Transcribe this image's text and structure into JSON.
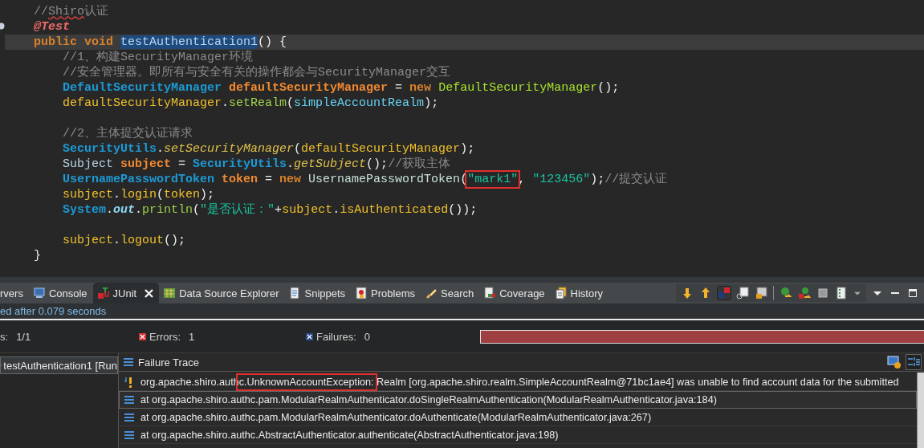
{
  "editor": {
    "lines": [
      {
        "current": false,
        "tokens": [
          {
            "text": "//",
            "kind": "comment"
          },
          {
            "text": "Shiro",
            "kind": "comment-misspelled"
          },
          {
            "text": "认证",
            "kind": "comment"
          }
        ]
      },
      {
        "current": false,
        "tokens": [
          {
            "text": "@Test",
            "kind": "annotation"
          }
        ]
      },
      {
        "current": true,
        "tokens": [
          {
            "text": "public ",
            "kind": "keyword"
          },
          {
            "text": "void ",
            "kind": "keyword"
          },
          {
            "text": "testAuthentication1",
            "kind": "occurrence"
          },
          {
            "text": "() {",
            "kind": "plain"
          }
        ],
        "children": [
          {
            "current": false,
            "tokens": [
              {
                "text": "//1、构建SecurityManager环境",
                "kind": "comment"
              }
            ]
          },
          {
            "current": false,
            "tokens": [
              {
                "text": "//安全管理器。即所有与安全有关的操作都会与SecurityManager交互",
                "kind": "comment"
              }
            ]
          },
          {
            "current": false,
            "tokens": [
              {
                "text": "DefaultSecurityManager ",
                "kind": "type"
              },
              {
                "text": "defaultSecurityManager",
                "kind": "local-decl"
              },
              {
                "text": " = ",
                "kind": "plain"
              },
              {
                "text": "new ",
                "kind": "keyword"
              },
              {
                "text": "DefaultSecurityManager",
                "kind": "constructor"
              },
              {
                "text": "();",
                "kind": "plain"
              }
            ]
          },
          {
            "current": false,
            "tokens": [
              {
                "text": "defaultSecurityManager",
                "kind": "local"
              },
              {
                "text": ".",
                "kind": "plain"
              },
              {
                "text": "setRealm",
                "kind": "method"
              },
              {
                "text": "(",
                "kind": "plain"
              },
              {
                "text": "simpleAccountRealm",
                "kind": "field"
              },
              {
                "text": ");",
                "kind": "plain"
              }
            ]
          },
          {
            "current": false,
            "kind": "blank"
          },
          {
            "current": false,
            "tokens": [
              {
                "text": "//2、主体提交认证请求",
                "kind": "comment"
              }
            ]
          },
          {
            "current": false,
            "tokens": [
              {
                "text": "SecurityUtils",
                "kind": "type"
              },
              {
                "text": ".",
                "kind": "plain"
              },
              {
                "text": "setSecurityManager",
                "kind": "static-method"
              },
              {
                "text": "(",
                "kind": "plain"
              },
              {
                "text": "defaultSecurityManager",
                "kind": "local"
              },
              {
                "text": ");",
                "kind": "plain"
              }
            ]
          },
          {
            "current": false,
            "tokens": [
              {
                "text": "Subject ",
                "kind": "plain-type"
              },
              {
                "text": "subject",
                "kind": "local-decl"
              },
              {
                "text": " = ",
                "kind": "plain"
              },
              {
                "text": "SecurityUtils",
                "kind": "type"
              },
              {
                "text": ".",
                "kind": "plain"
              },
              {
                "text": "getSubject",
                "kind": "static-method"
              },
              {
                "text": "();",
                "kind": "plain"
              },
              {
                "text": "//获取主体",
                "kind": "comment"
              }
            ]
          },
          {
            "current": false,
            "tokens": [
              {
                "text": "UsernamePasswordToken ",
                "kind": "type"
              },
              {
                "text": "token",
                "kind": "local-decl"
              },
              {
                "text": " = ",
                "kind": "plain"
              },
              {
                "text": "new ",
                "kind": "keyword"
              },
              {
                "text": "UsernamePasswordToken",
                "kind": "class-ref"
              },
              {
                "text": "(",
                "kind": "plain"
              },
              {
                "text": "\"mark1\"",
                "kind": "boxed-string"
              },
              {
                "text": ", ",
                "kind": "plain"
              },
              {
                "text": "\"123456\"",
                "kind": "string"
              },
              {
                "text": ");",
                "kind": "plain"
              },
              {
                "text": "//提交认证",
                "kind": "comment"
              }
            ]
          },
          {
            "current": false,
            "tokens": [
              {
                "text": "subject",
                "kind": "local"
              },
              {
                "text": ".",
                "kind": "plain"
              },
              {
                "text": "login",
                "kind": "local"
              },
              {
                "text": "(",
                "kind": "plain"
              },
              {
                "text": "token",
                "kind": "local"
              },
              {
                "text": ");",
                "kind": "plain"
              }
            ]
          },
          {
            "current": false,
            "tokens": [
              {
                "text": "System",
                "kind": "type"
              },
              {
                "text": ".",
                "kind": "plain"
              },
              {
                "text": "out",
                "kind": "static-field"
              },
              {
                "text": ".",
                "kind": "plain"
              },
              {
                "text": "println",
                "kind": "method"
              },
              {
                "text": "(",
                "kind": "plain"
              },
              {
                "text": "\"是否认证：\"",
                "kind": "string"
              },
              {
                "text": "+",
                "kind": "plain"
              },
              {
                "text": "subject",
                "kind": "local"
              },
              {
                "text": ".",
                "kind": "plain"
              },
              {
                "text": "isAuthenticated",
                "kind": "local"
              },
              {
                "text": "());",
                "kind": "plain"
              }
            ]
          },
          {
            "current": false,
            "kind": "blank"
          },
          {
            "current": false,
            "tokens": [
              {
                "text": "subject",
                "kind": "local"
              },
              {
                "text": ".",
                "kind": "plain"
              },
              {
                "text": "logout",
                "kind": "local"
              },
              {
                "text": "();",
                "kind": "plain"
              }
            ]
          }
        ]
      },
      {
        "current": false,
        "tokens": [
          {
            "text": "}",
            "kind": "plain"
          }
        ]
      }
    ]
  },
  "bottom_panel": {
    "tabs": [
      {
        "label": "rvers",
        "kind": "servers",
        "selected": false
      },
      {
        "label": "Console",
        "kind": "console",
        "selected": false
      },
      {
        "label": "JUnit",
        "kind": "junit",
        "selected": true
      },
      {
        "label": "Data Source Explorer",
        "kind": "datasource",
        "selected": false
      },
      {
        "label": "Snippets",
        "kind": "snippets",
        "selected": false
      },
      {
        "label": "Problems",
        "kind": "problems",
        "selected": false
      },
      {
        "label": "Search",
        "kind": "search",
        "selected": false
      },
      {
        "label": "Coverage",
        "kind": "coverage",
        "selected": false
      },
      {
        "label": "History",
        "kind": "history",
        "selected": false
      }
    ],
    "status": "ed after 0.079 seconds",
    "counters": [
      {
        "kind": "runs",
        "label": "s:",
        "value": "1/1"
      },
      {
        "kind": "errors",
        "label": "Errors:",
        "value": "1"
      },
      {
        "kind": "failures",
        "label": "Failures:",
        "value": "0"
      }
    ],
    "progress": {
      "level": 1,
      "failed": true
    },
    "test_tree": [
      {
        "label": "testAuthentication1 [Run",
        "selected": true
      }
    ],
    "failure_trace": {
      "title": "Failure Trace",
      "lines": [
        {
          "kind": "exception",
          "selected": false,
          "segments": [
            {
              "text": "org.apache.shiro.auth",
              "kind": "plain"
            },
            {
              "text": "c.UnknownAccountException:",
              "kind": "boxed"
            },
            {
              "text": " Realm [org.apache.shiro.realm.SimpleAccountRealm@71bc1ae4] was unable to find account data for the submitted",
              "kind": "plain"
            }
          ]
        },
        {
          "kind": "frame",
          "selected": true,
          "segments": [
            {
              "text": "at org.apache.shiro.authc.pam.ModularRealmAuthenticator.doSingleRealmAuthentication(ModularRealmAuthenticator.java:184)",
              "kind": "plain"
            }
          ]
        },
        {
          "kind": "frame",
          "selected": false,
          "segments": [
            {
              "text": "at org.apache.shiro.authc.pam.ModularRealmAuthenticator.doAuthenticate(ModularRealmAuthenticator.java:267)",
              "kind": "plain"
            }
          ]
        },
        {
          "kind": "frame",
          "selected": false,
          "segments": [
            {
              "text": "at org.apache.shiro.authc.AbstractAuthenticator.authenticate(AbstractAuthenticator.java:198)",
              "kind": "plain"
            }
          ]
        }
      ]
    }
  }
}
